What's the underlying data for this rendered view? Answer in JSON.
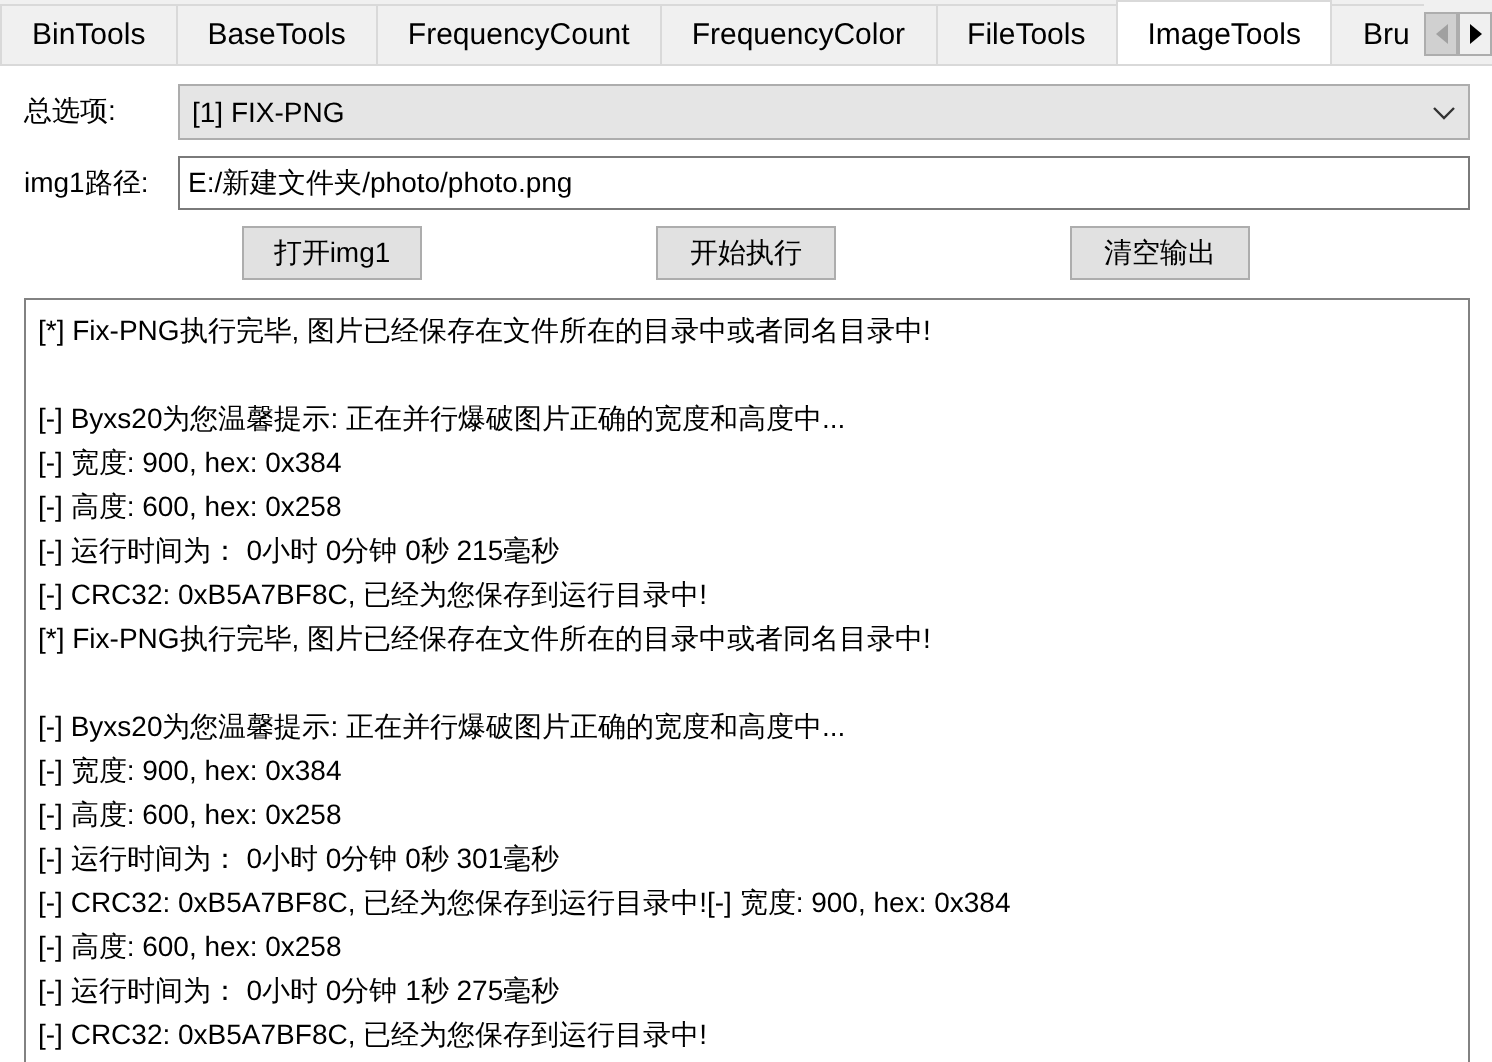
{
  "tabs": [
    {
      "label": "BinTools",
      "selected": false
    },
    {
      "label": "BaseTools",
      "selected": false
    },
    {
      "label": "FrequencyCount",
      "selected": false
    },
    {
      "label": "FrequencyColor",
      "selected": false
    },
    {
      "label": "FileTools",
      "selected": false
    },
    {
      "label": "ImageTools",
      "selected": true
    },
    {
      "label": "Bru",
      "selected": false
    }
  ],
  "form": {
    "option_label": "总选项:",
    "option_value": "[1] FIX-PNG",
    "path_label": "img1路径:",
    "path_value": "E:/新建文件夹/photo/photo.png"
  },
  "buttons": [
    "打开img1",
    "开始执行",
    "清空输出"
  ],
  "output": [
    [
      "[*] Fix-PNG执行完毕, 图片已经保存在文件所在的目录中或者同名目录中!"
    ],
    [
      "[-] Byxs20为您温馨提示: 正在并行爆破图片正确的宽度和高度中...",
      "[-] 宽度: 900, hex: 0x384",
      "[-] 高度: 600, hex: 0x258",
      "[-] 运行时间为： 0小时 0分钟 0秒 215毫秒",
      "[-] CRC32: 0xB5A7BF8C, 已经为您保存到运行目录中!",
      "[*] Fix-PNG执行完毕, 图片已经保存在文件所在的目录中或者同名目录中!"
    ],
    [
      "[-] Byxs20为您温馨提示: 正在并行爆破图片正确的宽度和高度中...",
      "[-] 宽度: 900, hex: 0x384",
      "[-] 高度: 600, hex: 0x258",
      "[-] 运行时间为： 0小时 0分钟 0秒 301毫秒",
      "[-] CRC32: 0xB5A7BF8C, 已经为您保存到运行目录中![-] 宽度: 900, hex: 0x384",
      "[-] 高度: 600, hex: 0x258",
      "[-] 运行时间为： 0小时 0分钟 1秒 275毫秒",
      "[-] CRC32: 0xB5A7BF8C, 已经为您保存到运行目录中!"
    ]
  ]
}
